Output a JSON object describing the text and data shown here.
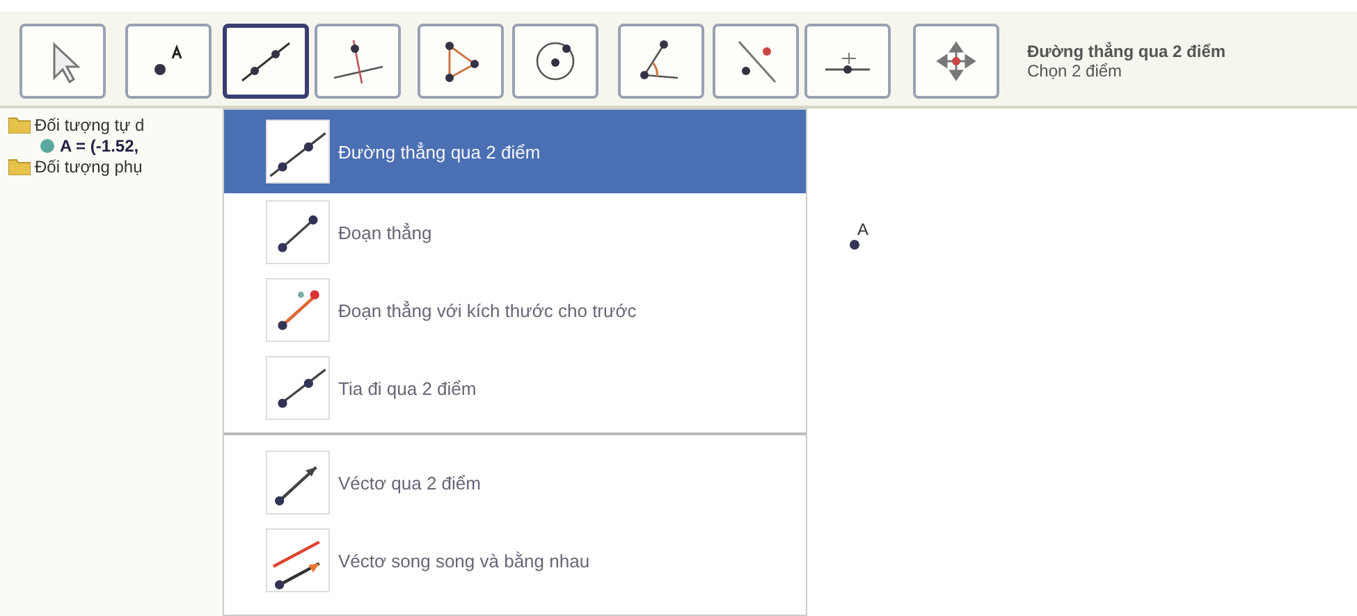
{
  "toolbar": {
    "tools": [
      {
        "kind": "pointer",
        "selected": false
      },
      {
        "kind": "point",
        "selected": false
      },
      {
        "kind": "line",
        "selected": true
      },
      {
        "kind": "perpendicular",
        "selected": false
      },
      {
        "kind": "polygon",
        "selected": false
      },
      {
        "kind": "circle",
        "selected": false
      },
      {
        "kind": "angle",
        "selected": false
      },
      {
        "kind": "reflect",
        "selected": false
      },
      {
        "kind": "slider",
        "selected": false
      },
      {
        "kind": "move-view",
        "selected": false
      }
    ],
    "tool_name": "Đường thẳng qua 2 điểm",
    "tool_hint": "Chọn 2 điểm"
  },
  "sidebar": {
    "items": [
      {
        "kind": "folder",
        "label": "Đối tượng tự d",
        "children": [
          {
            "label": "A = (-1.52,"
          }
        ]
      },
      {
        "kind": "folder",
        "label": "Đối tượng phụ"
      }
    ]
  },
  "canvas": {
    "points": [
      {
        "label": "A"
      }
    ]
  },
  "menu": {
    "groups": [
      {
        "items": [
          {
            "kind": "line",
            "label": "Đường thẳng qua 2 điểm",
            "selected": true
          },
          {
            "kind": "segment",
            "label": "Đoạn thẳng",
            "selected": false
          },
          {
            "kind": "segment-fixed",
            "label": "Đoạn thẳng với kích thước cho trước",
            "selected": false
          },
          {
            "kind": "ray",
            "label": "Tia đi qua 2 điểm",
            "selected": false
          }
        ]
      },
      {
        "items": [
          {
            "kind": "vector",
            "label": "Véctơ qua 2 điểm",
            "selected": false
          },
          {
            "kind": "vector-parallel",
            "label": "Véctơ song song và bằng nhau",
            "selected": false
          }
        ]
      }
    ]
  }
}
